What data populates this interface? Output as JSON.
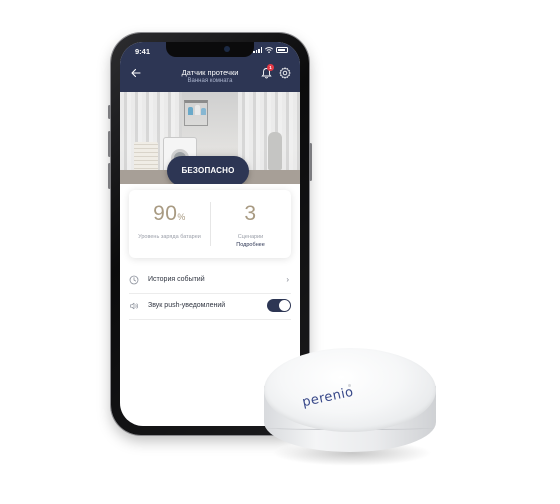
{
  "status_bar": {
    "time": "9:41"
  },
  "header": {
    "title": "Датчик протечки",
    "subtitle": "Ванная комната",
    "notification_count": "1"
  },
  "hero": {
    "status_label": "БЕЗОПАСНО"
  },
  "stats": {
    "battery": {
      "value": "90",
      "unit": "%",
      "label": "Уровень заряда батареи"
    },
    "scenarios": {
      "value": "3",
      "label": "Сценарии",
      "link": "Подробнее"
    }
  },
  "menu": {
    "event_history": {
      "label": "История событий",
      "chevron": "›"
    },
    "push_sound": {
      "label": "Звук push-уведомлений",
      "enabled": true
    }
  },
  "device": {
    "brand": "perenio"
  },
  "colors": {
    "brand_navy": "#2d3654",
    "stat_value": "#a89a82",
    "badge_red": "#e53946"
  },
  "icons": [
    "back-arrow-icon",
    "bell-icon",
    "gear-icon",
    "clock-icon",
    "speaker-icon",
    "chevron-right-icon"
  ]
}
